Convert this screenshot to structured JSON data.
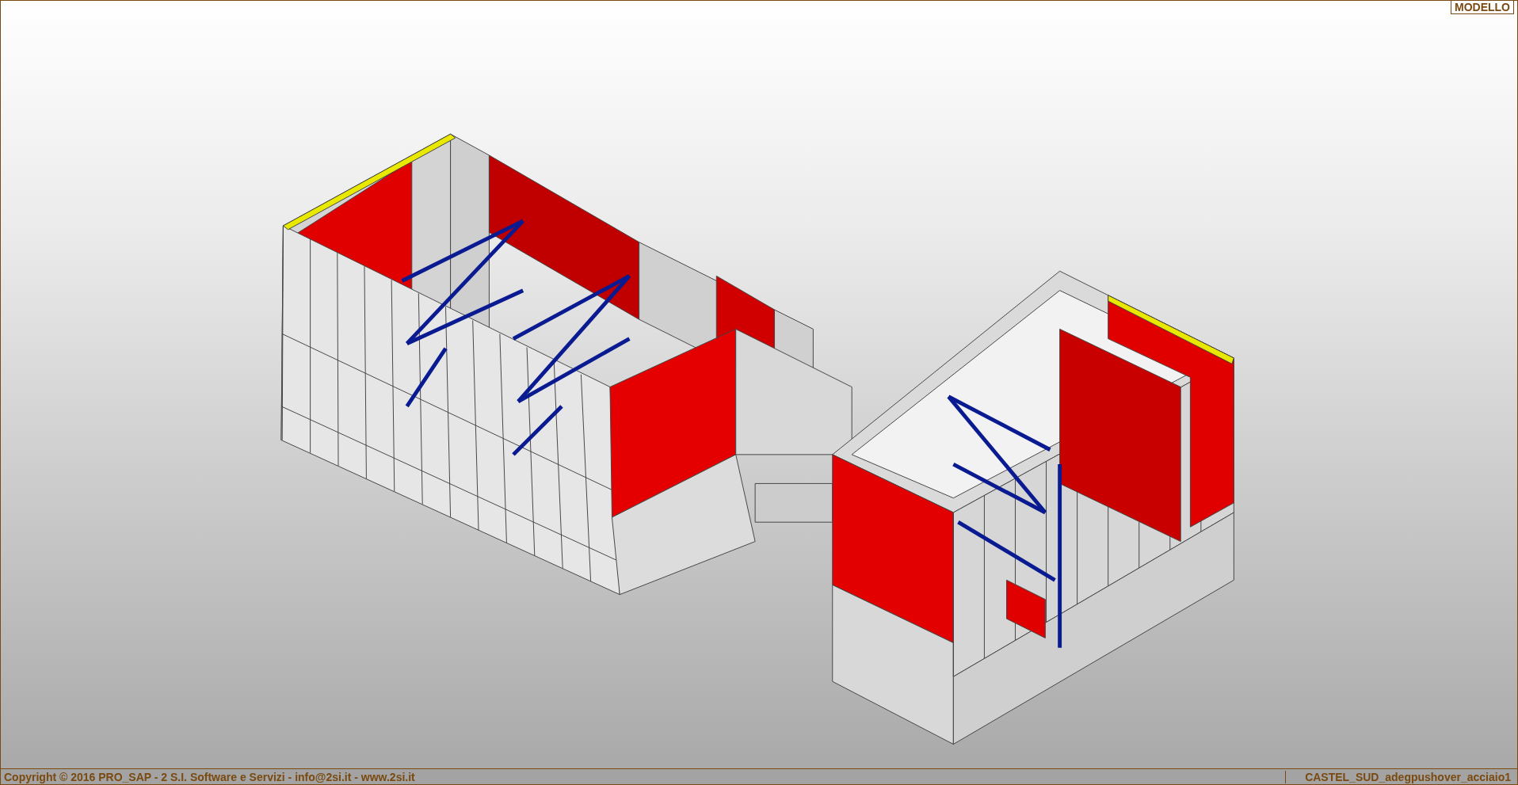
{
  "view_label": "MODELLO",
  "status_bar": {
    "copyright": "Copyright © 2016 PRO_SAP - 2 S.I. Software e Servizi - info@2si.it - www.2si.it",
    "file_name": "CASTEL_SUD_adegpushover_acciaio1"
  }
}
